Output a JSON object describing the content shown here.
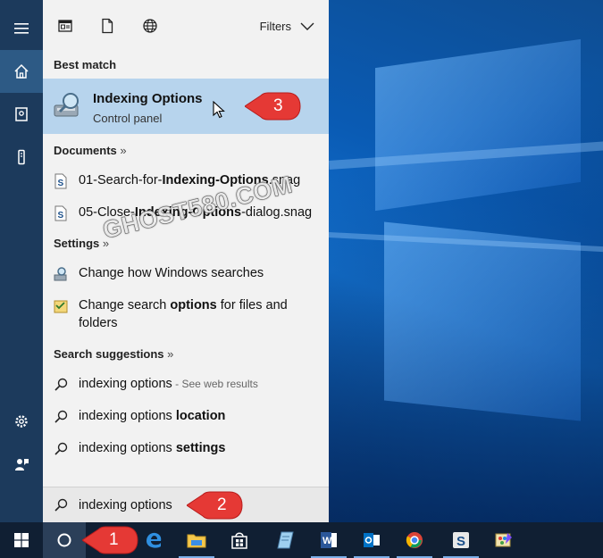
{
  "sidebar": {
    "items": [
      {
        "icon": "hamburger-menu-icon"
      },
      {
        "icon": "home-icon"
      },
      {
        "icon": "notebook-icon"
      },
      {
        "icon": "device-icon"
      },
      {
        "icon": "settings-icon"
      },
      {
        "icon": "feedback-icon"
      }
    ]
  },
  "topbar": {
    "filters_label": "Filters"
  },
  "best_match": {
    "header": "Best match",
    "title": "Indexing Options",
    "subtitle": "Control panel"
  },
  "documents": {
    "header": "Documents",
    "more": "»",
    "items": [
      {
        "pre": "01-Search-for-",
        "bold": "Indexing-Options",
        "post": ".snag"
      },
      {
        "pre": "05-Close-",
        "bold": "Indexing-Options",
        "post": "-dialog.snag"
      }
    ]
  },
  "settings": {
    "header": "Settings",
    "more": "»",
    "items": [
      {
        "pre": "Change how Windows searches",
        "bold": "",
        "post": ""
      },
      {
        "pre": "Change search ",
        "bold": "options",
        "post": " for files and folders"
      }
    ]
  },
  "suggestions": {
    "header": "Search suggestions",
    "more": "»",
    "items": [
      {
        "pre": "indexing options",
        "bold": "",
        "hint": " - See web results"
      },
      {
        "pre": "indexing options ",
        "bold": "location",
        "hint": ""
      },
      {
        "pre": "indexing options ",
        "bold": "settings",
        "hint": ""
      }
    ]
  },
  "search": {
    "value": "indexing options"
  },
  "callouts": {
    "one": "1",
    "two": "2",
    "three": "3"
  },
  "watermark": "GHOST580.COM",
  "colors": {
    "sidebar": "#1c3a5c",
    "best_match_highlight": "#b7d4ed",
    "taskbar": "#101f33",
    "callout": "#e53935"
  }
}
